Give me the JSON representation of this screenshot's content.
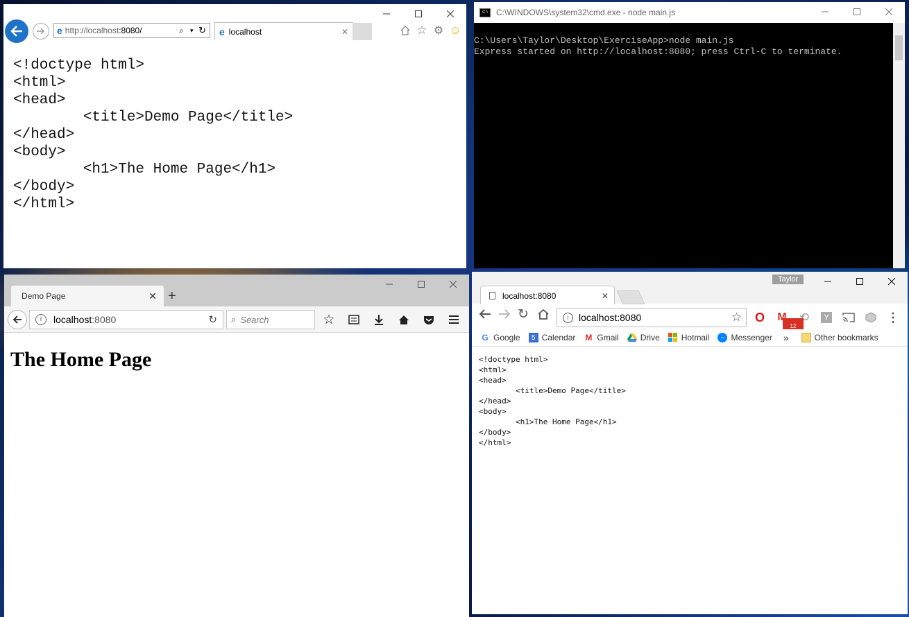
{
  "ie": {
    "address_host": "http://localhost",
    "address_port": ":8080/",
    "tab_title": "localhost",
    "source_lines": "<!doctype html>\n<html>\n<head>\n        <title>Demo Page</title>\n</head>\n<body>\n        <h1>The Home Page</h1>\n</body>\n</html>"
  },
  "cmd": {
    "title": "C:\\WINDOWS\\system32\\cmd.exe - node  main.js",
    "output": "C:\\Users\\Taylor\\Desktop\\ExerciseApp>node main.js\nExpress started on http://localhost:8080; press Ctrl-C to terminate."
  },
  "firefox": {
    "tab_title": "Demo Page",
    "url_host": "localhost",
    "url_port": ":8080",
    "search_placeholder": "Search",
    "heading": "The Home Page"
  },
  "chrome": {
    "profile_name": "Taylor",
    "tab_title": "localhost:8080",
    "url": "localhost:8080",
    "gmail_badge": "12",
    "bookmarks": [
      {
        "label": "Google"
      },
      {
        "label": "Calendar"
      },
      {
        "label": "Gmail"
      },
      {
        "label": "Drive"
      },
      {
        "label": "Hotmail"
      },
      {
        "label": "Messenger"
      }
    ],
    "overflow": "»",
    "other_bookmarks": "Other bookmarks",
    "calendar_day": "5",
    "source_lines": "<!doctype html>\n<html>\n<head>\n        <title>Demo Page</title>\n</head>\n<body>\n        <h1>The Home Page</h1>\n</body>\n</html>"
  }
}
